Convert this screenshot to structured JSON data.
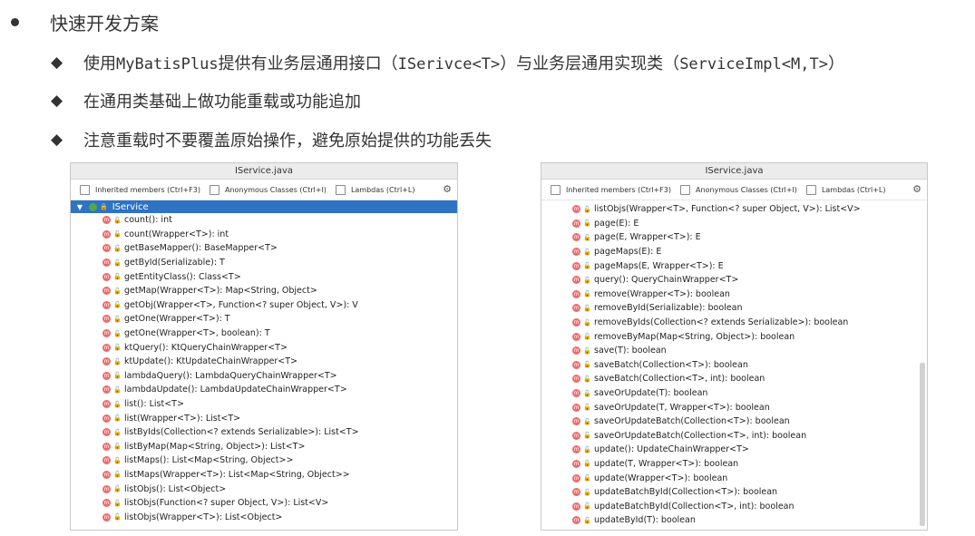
{
  "slide": {
    "heading": "快速开发方案",
    "points": [
      {
        "pre": "使用",
        "code1": "MyBatisPlus",
        "mid1": "提供有业务层通用接口（",
        "code2": "ISerivce<T>",
        "mid2": "）与业务层通用实现类（",
        "code3": "ServiceImpl<M,T>",
        "post": "）"
      },
      {
        "text": "在通用类基础上做功能重载或功能追加"
      },
      {
        "text": "注意重载时不要覆盖原始操作，避免原始提供的功能丢失"
      }
    ]
  },
  "left_panel": {
    "title": "IService.java",
    "options": [
      "Inherited members (Ctrl+F3)",
      "Anonymous Classes (Ctrl+I)",
      "Lambdas (Ctrl+L)"
    ],
    "root": "IService",
    "methods": [
      "count(): int",
      "count(Wrapper<T>): int",
      "getBaseMapper(): BaseMapper<T>",
      "getById(Serializable): T",
      "getEntityClass(): Class<T>",
      "getMap(Wrapper<T>): Map<String, Object>",
      "getObj(Wrapper<T>, Function<? super Object, V>): V",
      "getOne(Wrapper<T>): T",
      "getOne(Wrapper<T>, boolean): T",
      "ktQuery(): KtQueryChainWrapper<T>",
      "ktUpdate(): KtUpdateChainWrapper<T>",
      "lambdaQuery(): LambdaQueryChainWrapper<T>",
      "lambdaUpdate(): LambdaUpdateChainWrapper<T>",
      "list(): List<T>",
      "list(Wrapper<T>): List<T>",
      "listByIds(Collection<? extends Serializable>): List<T>",
      "listByMap(Map<String, Object>): List<T>",
      "listMaps(): List<Map<String, Object>>",
      "listMaps(Wrapper<T>): List<Map<String, Object>>",
      "listObjs(): List<Object>",
      "listObjs(Function<? super Object, V>): List<V>",
      "listObjs(Wrapper<T>): List<Object>"
    ]
  },
  "right_panel": {
    "title": "IService.java",
    "options": [
      "Inherited members (Ctrl+F3)",
      "Anonymous Classes (Ctrl+I)",
      "Lambdas (Ctrl+L)"
    ],
    "methods": [
      "listObjs(Wrapper<T>, Function<? super Object, V>): List<V>",
      "page(E): E",
      "page(E, Wrapper<T>): E",
      "pageMaps(E): E",
      "pageMaps(E, Wrapper<T>): E",
      "query(): QueryChainWrapper<T>",
      "remove(Wrapper<T>): boolean",
      "removeById(Serializable): boolean",
      "removeByIds(Collection<? extends Serializable>): boolean",
      "removeByMap(Map<String, Object>): boolean",
      "save(T): boolean",
      "saveBatch(Collection<T>): boolean",
      "saveBatch(Collection<T>, int): boolean",
      "saveOrUpdate(T): boolean",
      "saveOrUpdate(T, Wrapper<T>): boolean",
      "saveOrUpdateBatch(Collection<T>): boolean",
      "saveOrUpdateBatch(Collection<T>, int): boolean",
      "update(): UpdateChainWrapper<T>",
      "update(T, Wrapper<T>): boolean",
      "update(Wrapper<T>): boolean",
      "updateBatchById(Collection<T>): boolean",
      "updateBatchById(Collection<T>, int): boolean",
      "updateById(T): boolean"
    ]
  },
  "icons": {
    "method": "method-icon",
    "lock": "lock-icon",
    "gear": "gear-icon",
    "class": "interface-icon"
  }
}
